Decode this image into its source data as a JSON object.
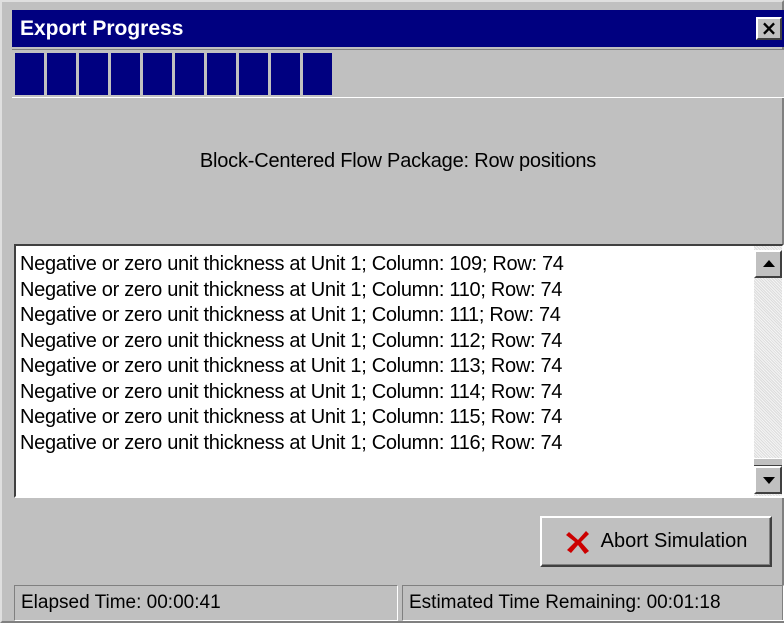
{
  "window": {
    "title": "Export Progress",
    "close_label": "×"
  },
  "progress": {
    "filled_blocks": 10,
    "color": "#000080"
  },
  "status": {
    "message": "Block-Centered Flow Package: Row positions"
  },
  "log": {
    "lines": [
      "Negative or zero unit thickness at Unit 1; Column: 109; Row: 74",
      "Negative or zero unit thickness at Unit 1; Column: 110; Row: 74",
      "Negative or zero unit thickness at Unit 1; Column: 111; Row: 74",
      "Negative or zero unit thickness at Unit 1; Column: 112; Row: 74",
      "Negative or zero unit thickness at Unit 1; Column: 113; Row: 74",
      "Negative or zero unit thickness at Unit 1; Column: 114; Row: 74",
      "Negative or zero unit thickness at Unit 1; Column: 115; Row: 74",
      "Negative or zero unit thickness at Unit 1; Column: 116; Row: 74"
    ]
  },
  "actions": {
    "abort_label": "Abort Simulation",
    "abort_icon": "red-x-icon",
    "abort_icon_color": "#cc0000"
  },
  "statusbar": {
    "elapsed": "Elapsed Time: 00:00:41",
    "remaining": "Estimated Time Remaining: 00:01:18"
  }
}
